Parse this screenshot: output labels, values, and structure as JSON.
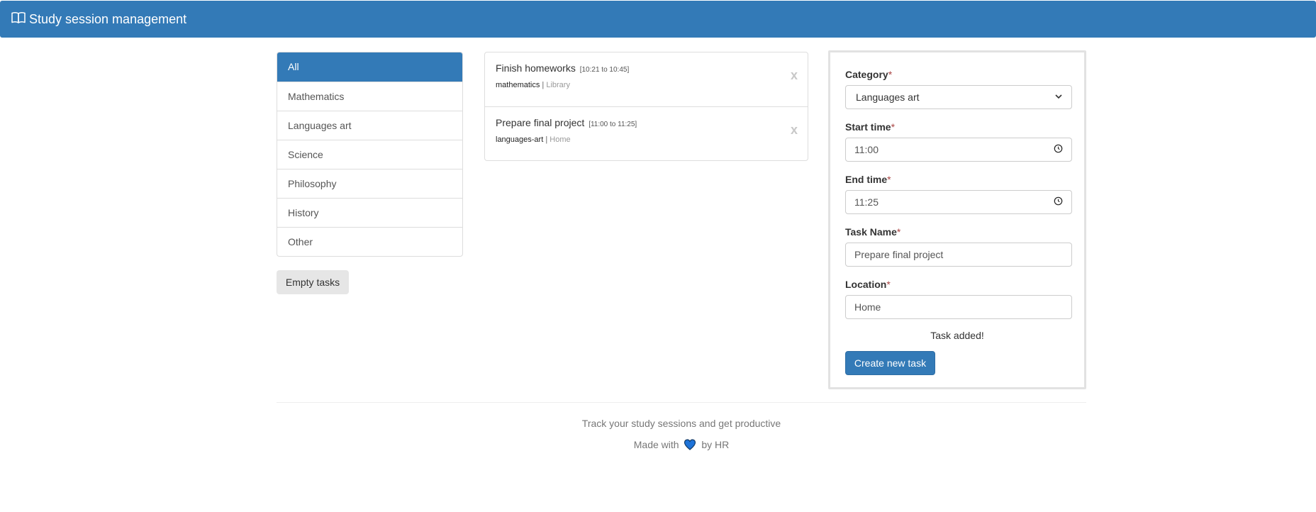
{
  "header": {
    "icon": "book-icon",
    "title": "Study session management"
  },
  "categories": [
    {
      "label": "All",
      "active": true
    },
    {
      "label": "Mathematics",
      "active": false
    },
    {
      "label": "Languages art",
      "active": false
    },
    {
      "label": "Science",
      "active": false
    },
    {
      "label": "Philosophy",
      "active": false
    },
    {
      "label": "History",
      "active": false
    },
    {
      "label": "Other",
      "active": false
    }
  ],
  "empty_tasks_label": "Empty tasks",
  "tasks": [
    {
      "name": "Finish homeworks",
      "time": "[10:21 to 10:45]",
      "category": "mathematics",
      "separator": "|",
      "location": "Library",
      "remove_label": "x"
    },
    {
      "name": "Prepare final project",
      "time": "[11:00 to 11:25]",
      "category": "languages-art",
      "separator": "|",
      "location": "Home",
      "remove_label": "x"
    }
  ],
  "form": {
    "required_mark": "*",
    "category": {
      "label": "Category",
      "value": "Languages art"
    },
    "start_time": {
      "label": "Start time",
      "value": "11:00"
    },
    "end_time": {
      "label": "End time",
      "value": "11:25"
    },
    "task_name": {
      "label": "Task Name",
      "value": "Prepare final project"
    },
    "location": {
      "label": "Location",
      "value": "Home"
    },
    "status": "Task added!",
    "submit_label": "Create new task"
  },
  "footer": {
    "tagline": "Track your study sessions and get productive",
    "made_with": "Made with",
    "by": "by HR",
    "heart_icon": "heart-icon"
  },
  "colors": {
    "primary": "#337ab7",
    "heart": "#1e73d8"
  }
}
